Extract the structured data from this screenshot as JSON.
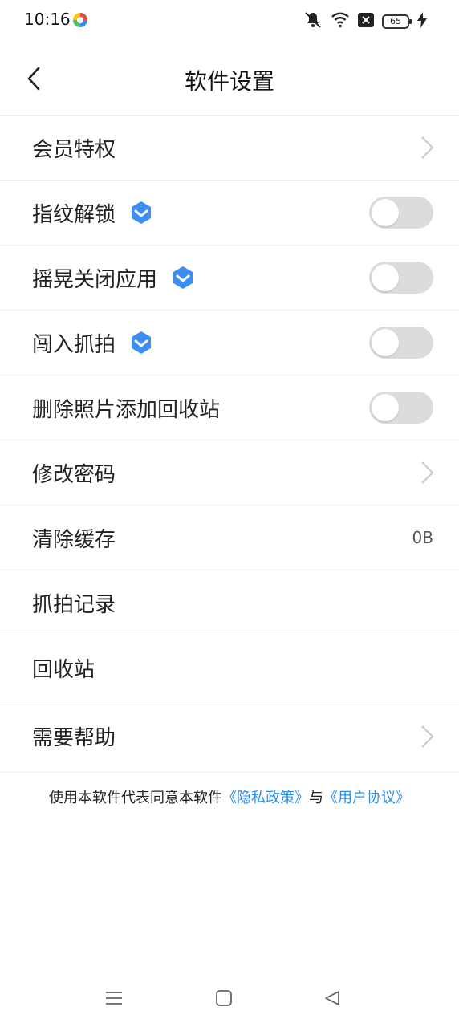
{
  "status_bar": {
    "time": "10:16",
    "battery_level": "65",
    "icons": [
      "app-logo-icon",
      "mute-icon",
      "wifi-icon",
      "no-sim-icon",
      "battery-icon",
      "charging-icon"
    ]
  },
  "header": {
    "title": "软件设置",
    "back_icon": "back-arrow-icon"
  },
  "settings": {
    "member": {
      "label": "会员特权"
    },
    "fingerprint": {
      "label": "指纹解锁",
      "enabled": false
    },
    "shake_close": {
      "label": "摇晃关闭应用",
      "enabled": false
    },
    "intruder_photo": {
      "label": "闯入抓拍",
      "enabled": false
    },
    "delete_to_trash": {
      "label": "删除照片添加回收站",
      "enabled": false
    },
    "change_password": {
      "label": "修改密码"
    },
    "clear_cache": {
      "label": "清除缓存",
      "value": "0B"
    },
    "capture_records": {
      "label": "抓拍记录"
    },
    "recycle_bin": {
      "label": "回收站"
    },
    "help": {
      "label": "需要帮助"
    }
  },
  "footer": {
    "agreement_prefix": "使用本软件代表同意本软件",
    "privacy_link": "《隐私政策》",
    "conjunction": "与",
    "user_agreement_link": "《用户协议》"
  },
  "colors": {
    "accent_link": "#2f8fe6",
    "vip_badge": "#3d8ef0",
    "toggle_off": "#dcdcdc",
    "divider": "#ececec"
  }
}
